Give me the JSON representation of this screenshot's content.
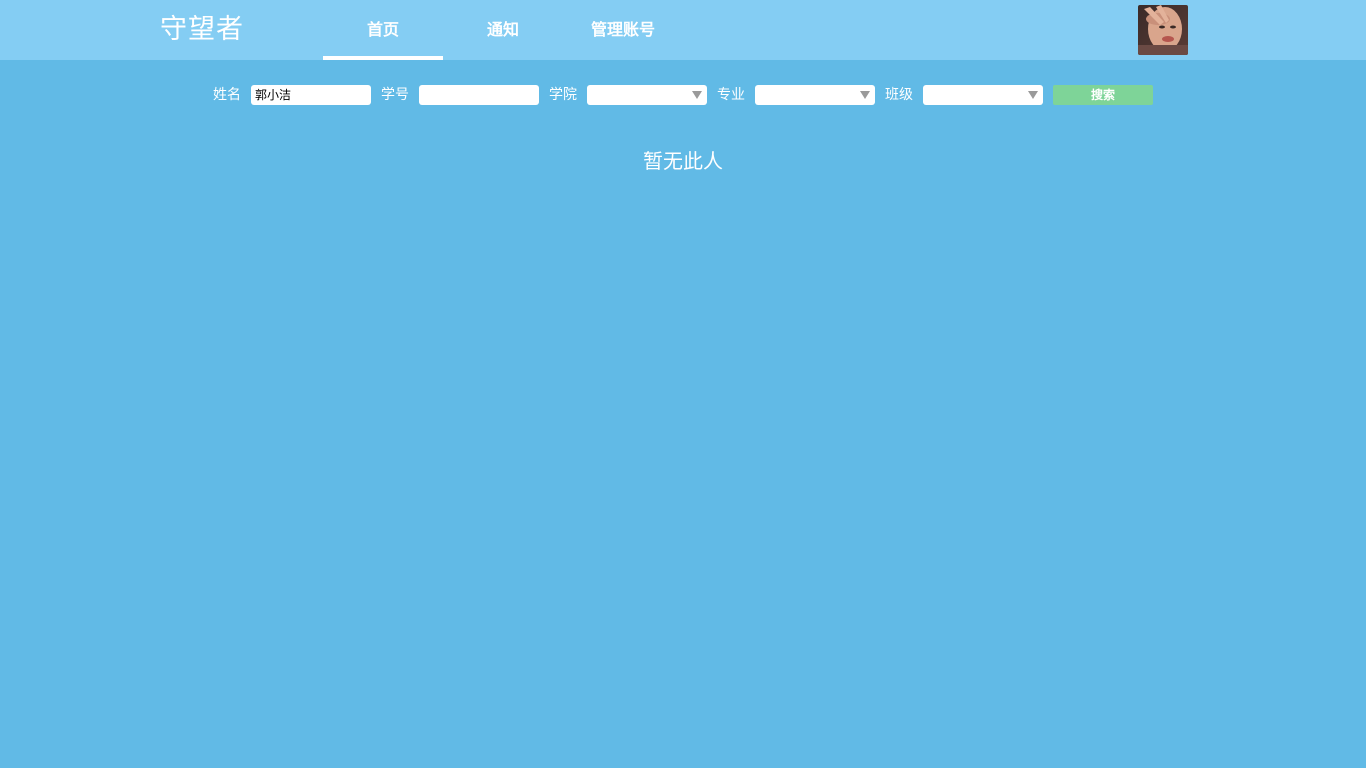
{
  "app": {
    "logo_text": "守望者"
  },
  "nav": {
    "tabs": [
      {
        "label": "首页",
        "active": true
      },
      {
        "label": "通知",
        "active": false
      },
      {
        "label": "管理账号",
        "active": false
      }
    ]
  },
  "user": {
    "avatar": "user-avatar-photo"
  },
  "search": {
    "name_label": "姓名",
    "name_value": "郭小洁",
    "student_id_label": "学号",
    "student_id_value": "",
    "college_label": "学院",
    "college_value": "",
    "major_label": "专业",
    "major_value": "",
    "class_label": "班级",
    "class_value": "",
    "button_label": "搜索"
  },
  "result": {
    "empty_message": "暂无此人"
  },
  "colors": {
    "page_bg": "#61bae6",
    "topbar_bg": "#84cdf3",
    "button_bg": "#7ed498",
    "text": "#ffffff"
  }
}
